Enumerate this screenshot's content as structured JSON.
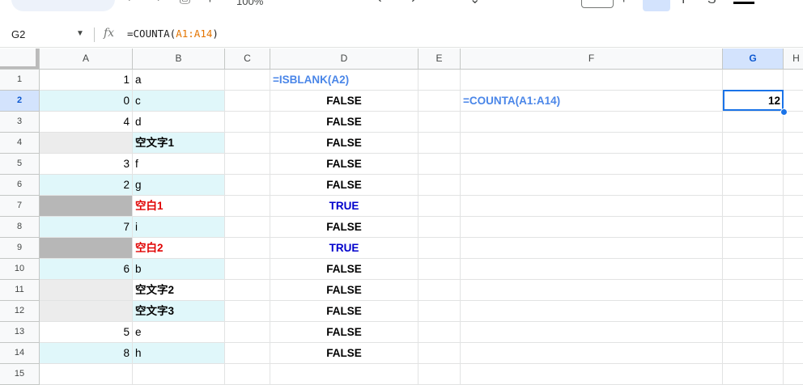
{
  "toolbar": {
    "zoom_label": "100%"
  },
  "formula_bar": {
    "name_box": "G2",
    "fx_label": "fx",
    "formula_prefix": "=COUNTA(",
    "formula_ref": "A1:A14",
    "formula_suffix": ")"
  },
  "columns": [
    "A",
    "B",
    "C",
    "D",
    "E",
    "F",
    "G",
    "H"
  ],
  "selected_column": "G",
  "rows": [
    1,
    2,
    3,
    4,
    5,
    6,
    7,
    8,
    9,
    10,
    11,
    12,
    13,
    14,
    15
  ],
  "selected_row": 2,
  "cells": {
    "A": [
      "1",
      "0",
      "4",
      "",
      "3",
      "2",
      "",
      "7",
      "",
      "6",
      "",
      "",
      "5",
      "8",
      ""
    ],
    "B": [
      "a",
      "c",
      "d",
      "空文字1",
      "f",
      "g",
      "空白1",
      "i",
      "空白2",
      "b",
      "空文字2",
      "空文字3",
      "e",
      "h",
      ""
    ],
    "D": [
      "=ISBLANK(A2)",
      "FALSE",
      "FALSE",
      "FALSE",
      "FALSE",
      "FALSE",
      "TRUE",
      "FALSE",
      "TRUE",
      "FALSE",
      "FALSE",
      "FALSE",
      "FALSE",
      "FALSE",
      ""
    ],
    "F2": "=COUNTA(A1:A14)",
    "G2": "12"
  },
  "colors": {
    "accent": "#1a73e8",
    "formula_text": "#4a86e8",
    "true_text": "#0000cc",
    "blank_label": "#e00000",
    "row_highlight": "#e0f7fa",
    "empty_string_cell": "#ececec",
    "blank_cell": "#b7b7b7"
  }
}
